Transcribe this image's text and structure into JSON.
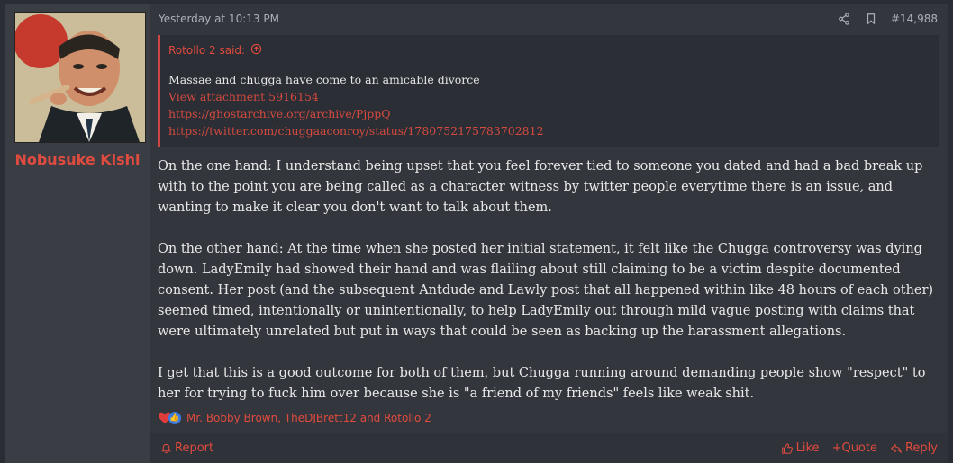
{
  "user": {
    "name": "Nobusuke Kishi"
  },
  "post": {
    "timestamp": "Yesterday at 10:13 PM",
    "number": "#14,988",
    "quote": {
      "author": "Rotollo 2 said:",
      "text": "Massae and chugga have come to an amicable divorce",
      "lines": [
        "View attachment 5916154",
        "https://ghostarchive.org/archive/PjppQ",
        "https://twitter.com/chuggaaconroy/status/1780752175783702812"
      ]
    },
    "paragraphs": [
      "On the one hand: I understand being upset that you feel forever tied to someone you dated and had a bad break up with to the point you are being called as a character witness by twitter people everytime there is an issue, and wanting to make it clear you don't want to talk about them.",
      "On the other hand: At the time when she posted her initial statement, it felt like the Chugga controversy was dying down. LadyEmily had showed their hand and was flailing about still claiming to be a victim despite documented consent. Her post (and the subsequent Antdude and Lawly post that all happened within like 48 hours of each other) seemed timed, intentionally or unintentionally, to help LadyEmily out through mild vague posting with claims that were ultimately unrelated but put in ways that could be seen as backing up the harassment allegations.",
      "I get that this is a good outcome for both of them, but Chugga running around demanding people show \"respect\" to her for trying to fuck him over because she is \"a friend of my friends\" feels like weak shit."
    ],
    "reactions_text": "Mr. Bobby Brown, TheDJBrett12 and Rotollo 2"
  },
  "footer": {
    "report": "Report",
    "like": "Like",
    "quote": "+Quote",
    "reply": "Reply"
  },
  "colors": {
    "accent": "#e04b3f",
    "background": "#2a2d33",
    "panel": "#33363c",
    "user_panel": "#3a3d44",
    "quote_bg": "#2b2e34"
  },
  "icons": [
    "share-icon",
    "bookmark-icon",
    "arrow-up-circle-icon",
    "heart-icon",
    "like-icon",
    "bell-icon",
    "thumbs-up-icon",
    "reply-icon"
  ]
}
